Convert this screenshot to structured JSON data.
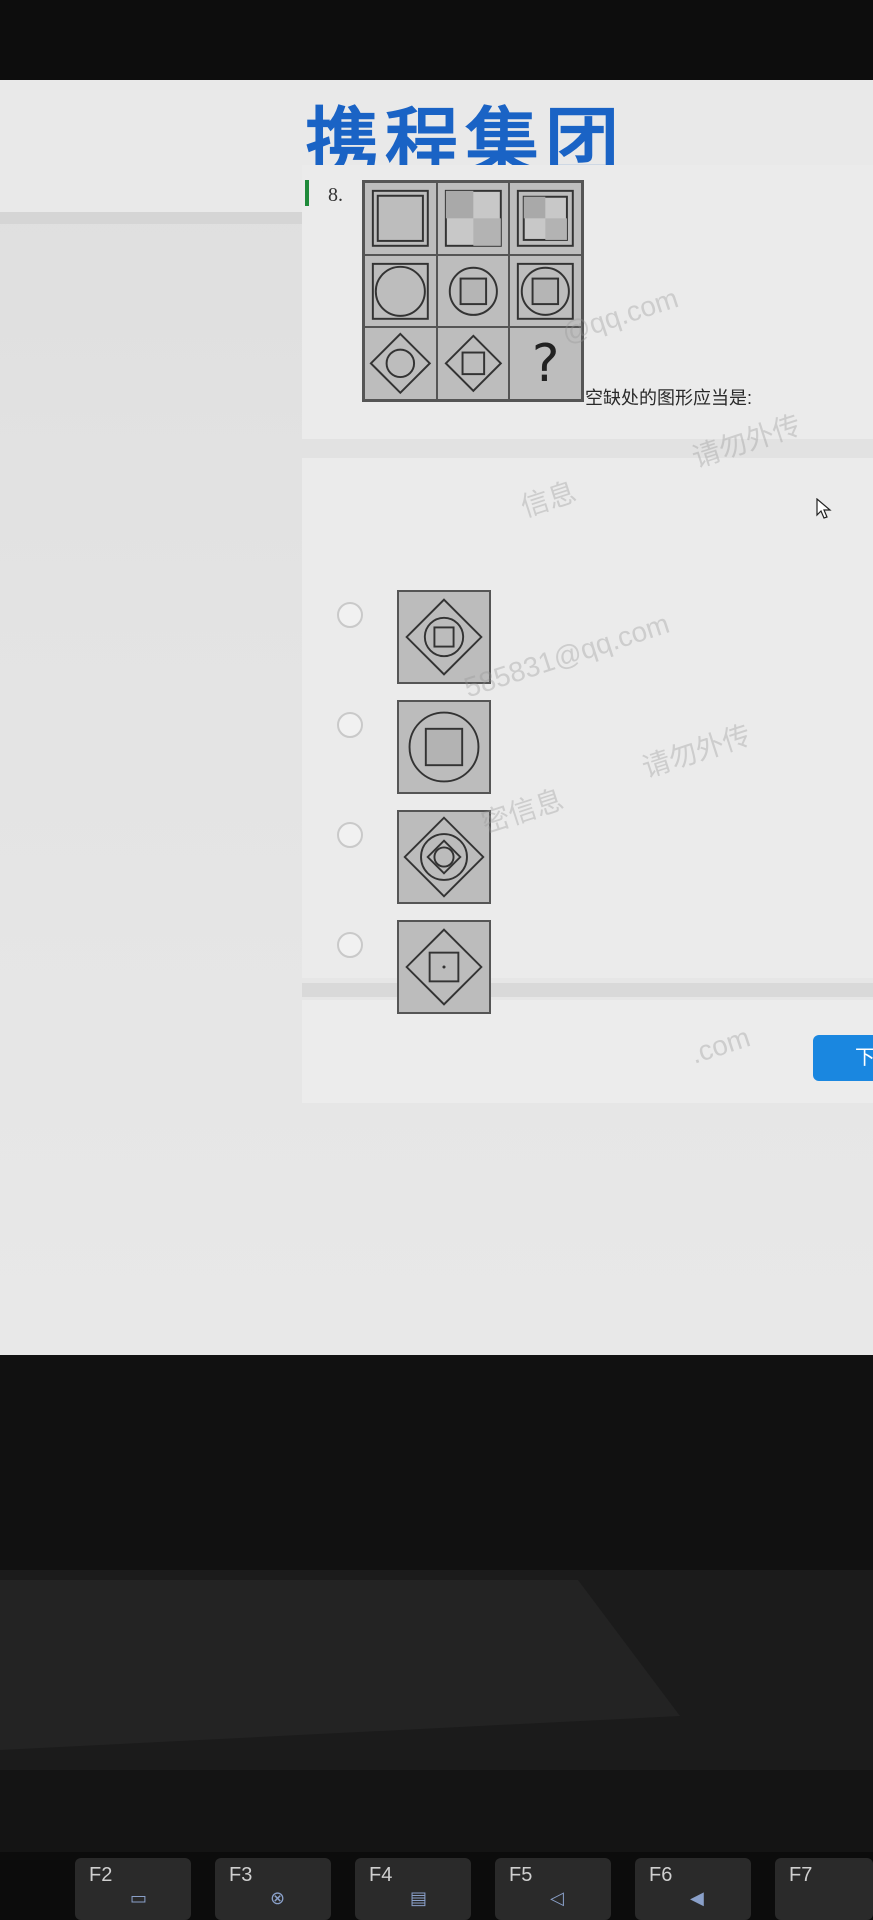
{
  "header": {
    "logo_text": "携程集团"
  },
  "question": {
    "number": "8.",
    "prompt": "空缺处的图形应当是:",
    "grid_placeholder": "?"
  },
  "options": [
    {
      "id": "A",
      "figure": "diamond with circle and inner square"
    },
    {
      "id": "B",
      "figure": "circle with inner square"
    },
    {
      "id": "C",
      "figure": "diamond with circle, inner diamond, inner circle"
    },
    {
      "id": "D",
      "figure": "diamond with inner square and center dot"
    }
  ],
  "footer": {
    "next_button_label": "下"
  },
  "watermarks": [
    "@qq.com",
    "请勿外传",
    "信息",
    "585831@qq.com",
    "请勿外传",
    "密信息",
    ".com"
  ],
  "keyboard": {
    "keys": [
      {
        "label": "F2"
      },
      {
        "label": "F3"
      },
      {
        "label": "F4"
      },
      {
        "label": "F5"
      },
      {
        "label": "F6"
      },
      {
        "label": "F7"
      }
    ]
  },
  "colors": {
    "logo_blue": "#1a63c5",
    "accent_green": "#1f8a3a",
    "button_blue": "#1a87e0"
  }
}
